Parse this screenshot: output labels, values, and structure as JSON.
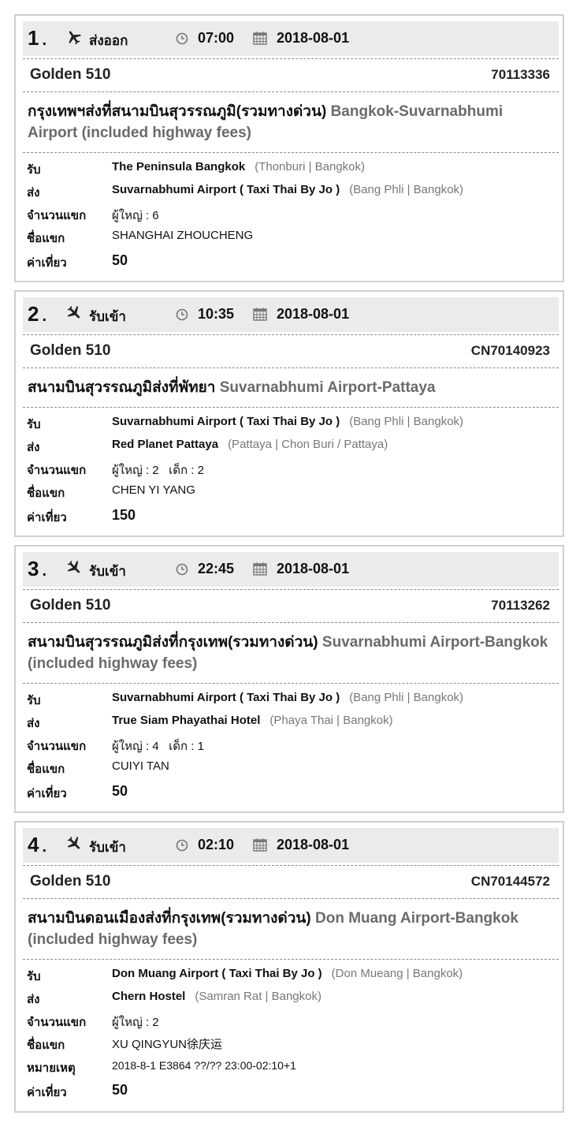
{
  "colors": {
    "header_bg": "#ebebeb",
    "border": "#d0d0d0",
    "english_route": "#6a6a6a",
    "location": "#777777"
  },
  "labels": {
    "pickup": "รับ",
    "dropoff": "ส่ง",
    "pax": "จำนวนแขก",
    "guest_name": "ชื่อแขก",
    "note": "หมายเหตุ",
    "fare": "ค่าเที่ยว",
    "adult": "ผู้ใหญ่ :",
    "child": "เด็ก :"
  },
  "bookings": [
    {
      "num": "1",
      "dot": ".",
      "plane_icon": "plane-takeoff-icon",
      "direction": "ส่งออก",
      "time": "07:00",
      "date": "2018-08-01",
      "company": "Golden 510",
      "code": "70113336",
      "route_th": "กรุงเทพฯส่งที่สนามบินสุวรรณภูมิ(รวมทางด่วน)",
      "route_en": "Bangkok-Suvarnabhumi Airport (included highway fees)",
      "pickup_name": "The Peninsula Bangkok",
      "pickup_loc": "(Thonburi | Bangkok)",
      "dropoff_name": "Suvarnabhumi Airport ( Taxi Thai By Jo )",
      "dropoff_loc": "(Bang Phli | Bangkok)",
      "adults": "6",
      "guest": "SHANGHAI ZHOUCHENG",
      "fare": "50"
    },
    {
      "num": "2",
      "dot": ".",
      "plane_icon": "plane-landing-icon",
      "direction": "รับเข้า",
      "time": "10:35",
      "date": "2018-08-01",
      "company": "Golden 510",
      "code": "CN70140923",
      "route_th": "สนามบินสุวรรณภูมิส่งที่พัทยา",
      "route_en": "Suvarnabhumi Airport-Pattaya",
      "pickup_name": "Suvarnabhumi Airport ( Taxi Thai By Jo )",
      "pickup_loc": "(Bang Phli | Bangkok)",
      "dropoff_name": "Red Planet Pattaya",
      "dropoff_loc": "(Pattaya | Chon Buri / Pattaya)",
      "adults": "2",
      "children": "2",
      "guest": "CHEN YI YANG",
      "fare": "150"
    },
    {
      "num": "3",
      "dot": ".",
      "plane_icon": "plane-landing-icon",
      "direction": "รับเข้า",
      "time": "22:45",
      "date": "2018-08-01",
      "company": "Golden 510",
      "code": "70113262",
      "route_th": "สนามบินสุวรรณภูมิส่งที่กรุงเทพ(รวมทางด่วน)",
      "route_en": "Suvarnabhumi Airport-Bangkok (included highway fees)",
      "pickup_name": "Suvarnabhumi Airport ( Taxi Thai By Jo )",
      "pickup_loc": "(Bang Phli | Bangkok)",
      "dropoff_name": "True Siam Phayathai Hotel",
      "dropoff_loc": "(Phaya Thai | Bangkok)",
      "adults": "4",
      "children": "1",
      "guest": "CUIYI TAN",
      "fare": "50"
    },
    {
      "num": "4",
      "dot": ".",
      "plane_icon": "plane-landing-icon",
      "direction": "รับเข้า",
      "time": "02:10",
      "date": "2018-08-01",
      "company": "Golden 510",
      "code": "CN70144572",
      "route_th": "สนามบินดอนเมืองส่งที่กรุงเทพ(รวมทางด่วน)",
      "route_en": "Don Muang Airport-Bangkok (included highway fees)",
      "pickup_name": "Don Muang Airport ( Taxi Thai By Jo )",
      "pickup_loc": "(Don Mueang | Bangkok)",
      "dropoff_name": "Chern Hostel",
      "dropoff_loc": "(Samran Rat | Bangkok)",
      "adults": "2",
      "guest": "XU QINGYUN徐庆运",
      "note": "2018-8-1 E3864 ??/?? 23:00-02:10+1",
      "fare": "50"
    }
  ]
}
